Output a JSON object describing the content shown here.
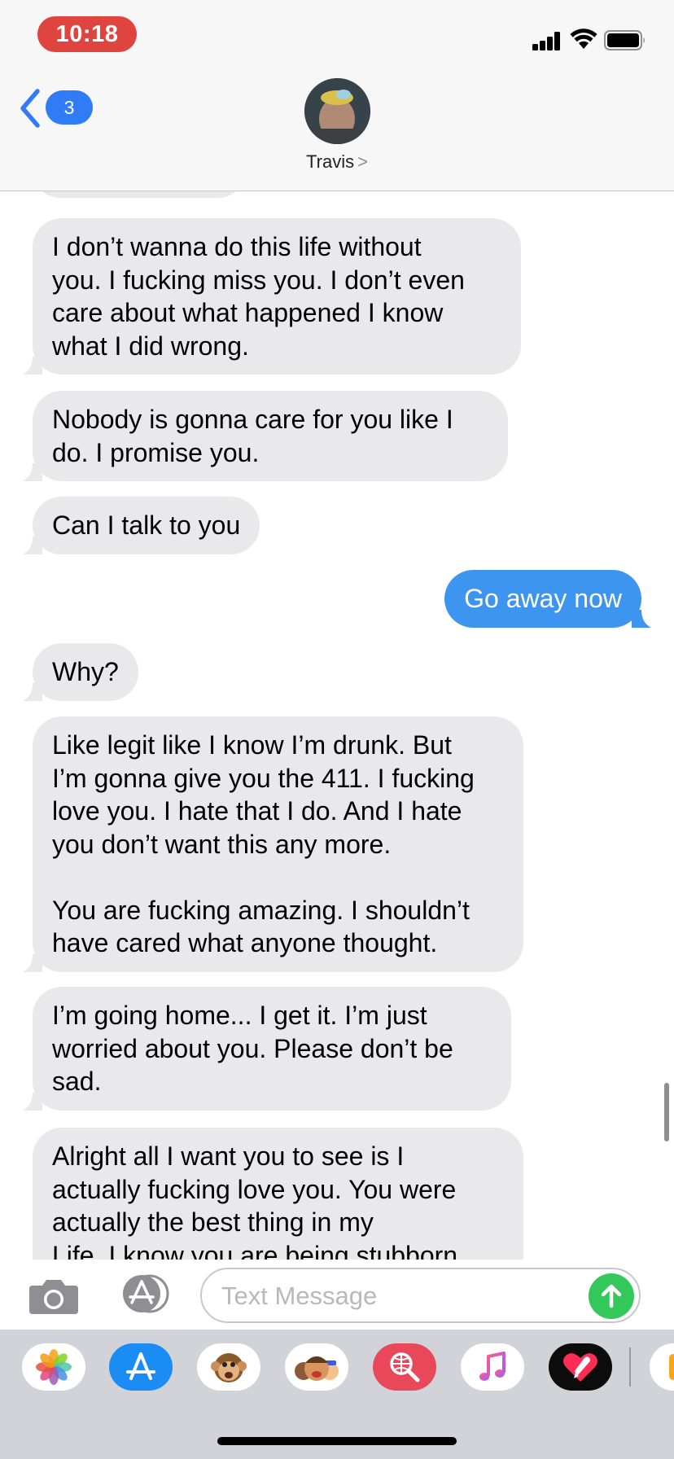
{
  "status_bar": {
    "time": "10:18",
    "signal_icon": "cellular-signal-icon",
    "wifi_icon": "wifi-icon",
    "battery_icon": "battery-icon"
  },
  "header": {
    "back_badge_count": "3",
    "back_icon": "chevron-left-icon",
    "contact_name": "Travis",
    "contact_chevron": ">"
  },
  "messages": [
    {
      "direction": "incoming",
      "text": ""
    },
    {
      "direction": "incoming",
      "text": "I don’t wanna do this life without\nyou. I fucking miss you. I don’t even\ncare about what happened I know\nwhat I did wrong."
    },
    {
      "direction": "incoming",
      "text": "Nobody is gonna care for you like I\ndo. I promise you."
    },
    {
      "direction": "incoming",
      "text": "Can I talk to you"
    },
    {
      "direction": "outgoing",
      "text": "Go away now"
    },
    {
      "direction": "incoming",
      "text": "Why?"
    },
    {
      "direction": "incoming",
      "text": "Like legit like I know I’m drunk. But\nI’m gonna give you the 411. I fucking\nlove you. I hate that I do. And I hate\nyou don’t want this any more.\n\nYou are fucking amazing. I shouldn’t\nhave cared what anyone thought."
    },
    {
      "direction": "incoming",
      "text": "I’m going home...  I get it. I’m just\nworried about you. Please don’t be\nsad."
    },
    {
      "direction": "incoming",
      "text": "Alright all I want you to see is I\nactually fucking love you. You were\nactually the best thing in my\nLife. I know you are being stubborn"
    }
  ],
  "input_bar": {
    "camera_icon": "camera-icon",
    "apps_icon": "app-store-icon",
    "placeholder": "Text Message",
    "value": "",
    "send_icon": "send-arrow-icon"
  },
  "app_drawer": {
    "apps": [
      "photos-icon",
      "app-store-icon",
      "animoji-icon",
      "memoji-icon",
      "web-search-icon",
      "music-icon",
      "digital-touch-icon",
      "stickers-icon"
    ]
  },
  "colors": {
    "incoming_bubble": "#e9e9eb",
    "outgoing_bubble": "#3e95f0",
    "accent": "#2f7cf6",
    "send_button": "#34c759",
    "time_pill": "#e0443e"
  }
}
